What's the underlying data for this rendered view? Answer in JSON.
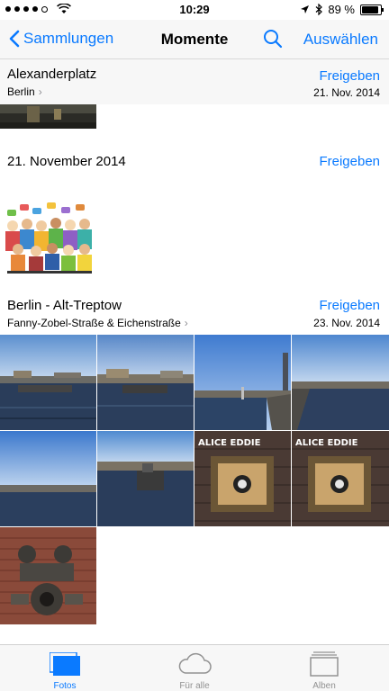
{
  "status_bar": {
    "time": "10:29",
    "battery": "89 %",
    "battery_level": 0.89,
    "signal_icon": "signal-dots-icon",
    "wifi_icon": "wifi-icon"
  },
  "nav": {
    "back_label": "Sammlungen",
    "title": "Momente",
    "select_label": "Auswählen",
    "accent": "#0a7aff"
  },
  "moments": [
    {
      "title": "Alexanderplatz",
      "location": "Berlin",
      "share_label": "Freigeben",
      "date": "21. Nov. 2014"
    },
    {
      "title": "21. November 2014",
      "share_label": "Freigeben"
    },
    {
      "title": "Berlin - Alt-Treptow",
      "location": "Fanny-Zobel-Straße & Eichenstraße",
      "share_label": "Freigeben",
      "date": "23. Nov. 2014"
    }
  ],
  "graffiti_text": "ALICE EDDIE",
  "tabs": [
    {
      "label": "Fotos",
      "icon": "photos-icon",
      "active": true
    },
    {
      "label": "Für alle",
      "icon": "cloud-icon",
      "active": false
    },
    {
      "label": "Alben",
      "icon": "albums-icon",
      "active": false
    }
  ]
}
